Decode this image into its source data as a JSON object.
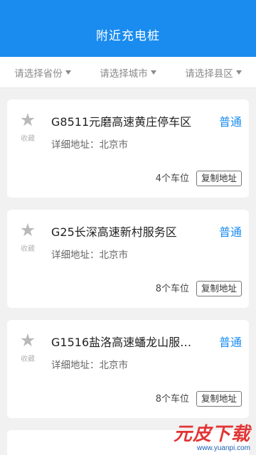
{
  "header": {
    "title": "附近充电桩"
  },
  "filters": [
    {
      "label": "请选择省份"
    },
    {
      "label": "请选择城市"
    },
    {
      "label": "请选择县区"
    }
  ],
  "stations": [
    {
      "title": "G8511元磨高速黄庄停车区",
      "type": "普通",
      "address": "详细地址：北京市",
      "spots": "4个车位",
      "copy_label": "复制地址",
      "fav_label": "收藏"
    },
    {
      "title": "G25长深高速新村服务区",
      "type": "普通",
      "address": "详细地址：北京市",
      "spots": "8个车位",
      "copy_label": "复制地址",
      "fav_label": "收藏"
    },
    {
      "title": "G1516盐洛高速蟠龙山服…",
      "type": "普通",
      "address": "详细地址：北京市",
      "spots": "8个车位",
      "copy_label": "复制地址",
      "fav_label": "收藏"
    }
  ],
  "watermark": {
    "brand": "元皮下载",
    "url": "www.yuanpi.com"
  },
  "colors": {
    "accent": "#1a8cf0",
    "background": "#f1f1f1"
  }
}
